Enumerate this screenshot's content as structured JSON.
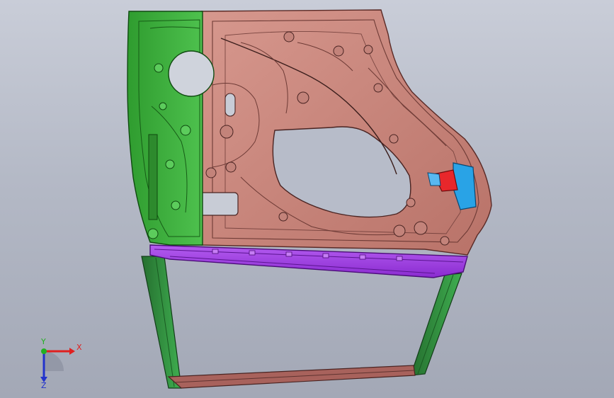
{
  "viewport": {
    "background_top": "#c9cdd8",
    "background_bottom": "#a3a8b6"
  },
  "model": {
    "parts": [
      {
        "name": "inner-panel",
        "color": "#c98a80"
      },
      {
        "name": "hinge-reinforcement",
        "color": "#3fae3f"
      },
      {
        "name": "belt-line-reinforcement",
        "color": "#a640e6"
      },
      {
        "name": "latch-bracket",
        "color": "#e8272b"
      },
      {
        "name": "latch-reinforcement",
        "color": "#29a3e6"
      },
      {
        "name": "window-frame-front",
        "color": "#2f9a45"
      },
      {
        "name": "window-frame-rear",
        "color": "#2f9a45"
      },
      {
        "name": "window-frame-top",
        "color": "#b56d66"
      }
    ]
  },
  "triad": {
    "x_label": "X",
    "y_label": "Y",
    "z_label": "Z",
    "x_color": "#e02020",
    "y_color": "#22b022",
    "z_color": "#2233cc"
  }
}
